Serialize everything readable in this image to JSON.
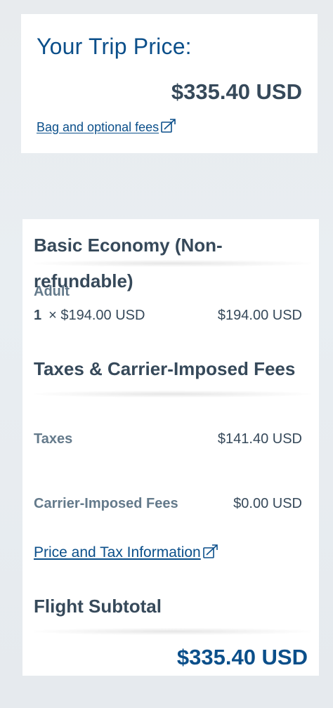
{
  "trip_price": {
    "title": "Your Trip Price:",
    "amount": "$335.40 USD",
    "bag_link": "Bag and optional fees"
  },
  "fare": {
    "title": "Basic Economy (Non-refundable)",
    "passenger_type": "Adult",
    "quantity": "1",
    "unit_price": "× $194.00 USD",
    "total": "$194.00 USD"
  },
  "taxes": {
    "title": "Taxes & Carrier-Imposed Fees",
    "rows": [
      {
        "label": "Taxes",
        "value": "$141.40 USD"
      },
      {
        "label": "Carrier-Imposed Fees",
        "value": "$0.00 USD"
      }
    ],
    "info_link": "Price and Tax Information"
  },
  "subtotal": {
    "title": "Flight Subtotal",
    "amount": "$335.40 USD"
  },
  "colors": {
    "brand_blue": "#0b4f8a",
    "text_dark": "#36495a",
    "text_muted": "#647a8b"
  },
  "icons": {
    "external_link": "external-link-icon"
  }
}
